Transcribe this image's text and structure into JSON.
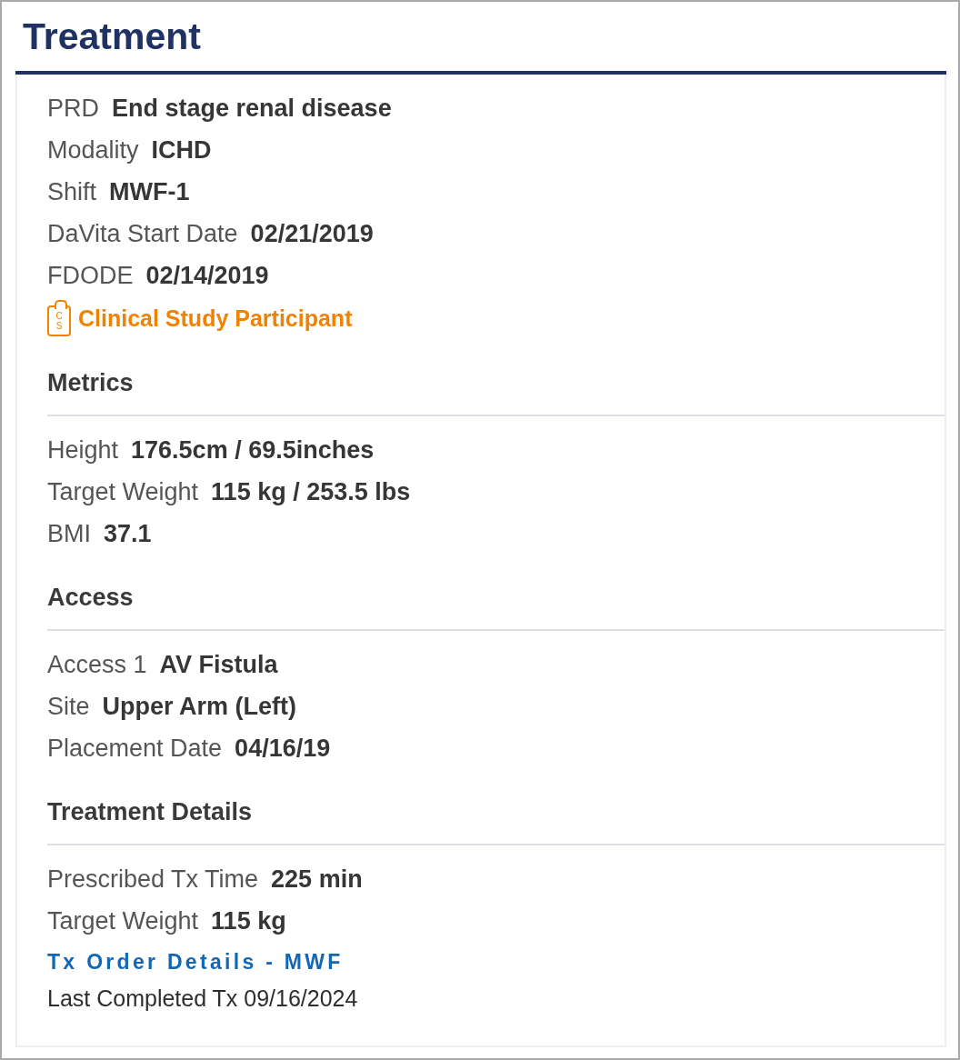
{
  "title": "Treatment",
  "summary": {
    "fields": [
      {
        "label": "PRD",
        "value": "End stage renal disease"
      },
      {
        "label": "Modality",
        "value": "ICHD"
      },
      {
        "label": "Shift",
        "value": "MWF-1"
      },
      {
        "label": "DaVita Start Date",
        "value": "02/21/2019"
      },
      {
        "label": "FDODE",
        "value": "02/14/2019"
      }
    ],
    "flag": {
      "badge": "CS",
      "text": "Clinical Study Participant"
    }
  },
  "sections": [
    {
      "heading": "Metrics",
      "fields": [
        {
          "label": "Height",
          "value": "176.5cm / 69.5inches"
        },
        {
          "label": "Target Weight",
          "value": "115 kg / 253.5 lbs"
        },
        {
          "label": "BMI",
          "value": "37.1"
        }
      ]
    },
    {
      "heading": "Access",
      "fields": [
        {
          "label": "Access 1",
          "value": "AV Fistula"
        },
        {
          "label": "Site",
          "value": "Upper Arm (Left)"
        },
        {
          "label": "Placement Date",
          "value": "04/16/19"
        }
      ]
    },
    {
      "heading": "Treatment Details",
      "fields": [
        {
          "label": "Prescribed Tx Time",
          "value": "225 min"
        },
        {
          "label": "Target Weight",
          "value": "115 kg"
        }
      ],
      "link": "Tx Order Details - MWF",
      "note": "Last Completed Tx 09/16/2024"
    }
  ]
}
